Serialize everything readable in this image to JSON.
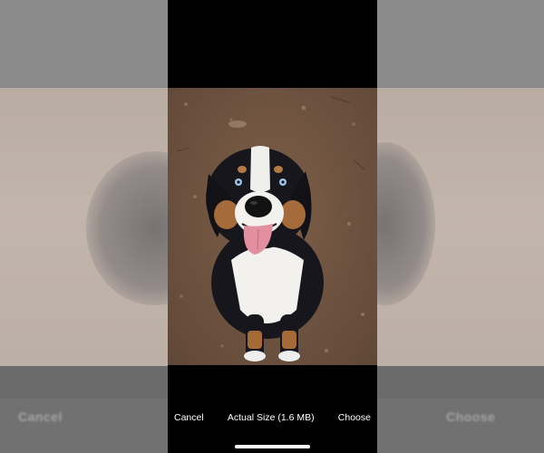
{
  "toolbar": {
    "cancel_label": "Cancel",
    "size_label": "Actual Size (1.6 MB)",
    "choose_label": "Choose"
  },
  "icons": {
    "home_indicator": "home-indicator-bar"
  },
  "colors": {
    "toolbar_text": "#ffffff",
    "preview_background": "#000000",
    "side_dim": "#7d7d7d"
  }
}
